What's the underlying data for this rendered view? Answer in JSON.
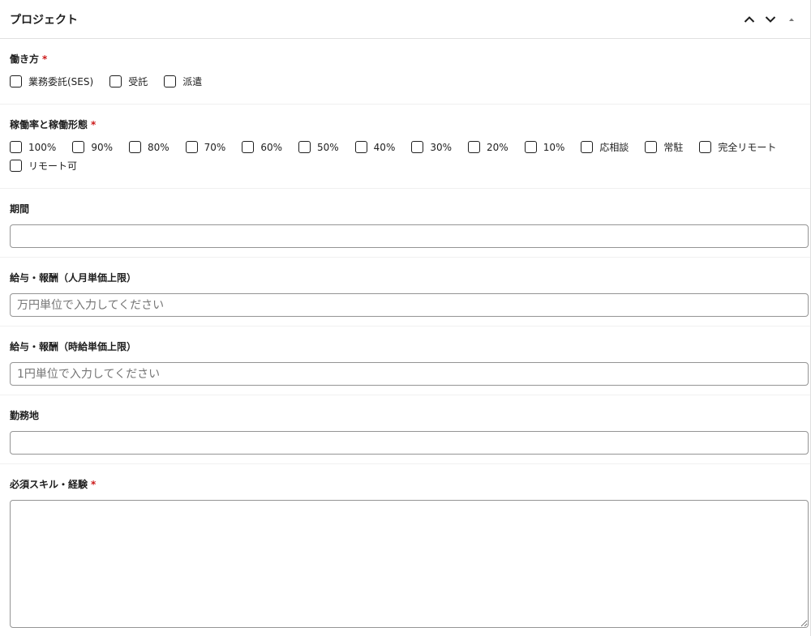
{
  "panel": {
    "title": "プロジェクト",
    "header_icons": [
      "chevron-up-icon",
      "chevron-down-icon",
      "triangle-up-icon"
    ]
  },
  "work_style": {
    "label": "働き方",
    "required_mark": "*",
    "options": [
      "業務委託(SES)",
      "受託",
      "派遣"
    ]
  },
  "utilization": {
    "label": "稼働率と稼働形態",
    "required_mark": "*",
    "options": [
      "100%",
      "90%",
      "80%",
      "70%",
      "60%",
      "50%",
      "40%",
      "30%",
      "20%",
      "10%",
      "応相談",
      "常駐",
      "完全リモート",
      "リモート可"
    ]
  },
  "period": {
    "label": "期間",
    "value": "",
    "placeholder": ""
  },
  "monthly_pay": {
    "label": "給与・報酬（人月単価上限）",
    "value": "",
    "placeholder": "万円単位で入力してください"
  },
  "hourly_pay": {
    "label": "給与・報酬（時給単価上限）",
    "value": "",
    "placeholder": "1円単位で入力してください"
  },
  "location": {
    "label": "勤務地",
    "value": "",
    "placeholder": ""
  },
  "skills": {
    "label": "必須スキル・経験",
    "required_mark": "*",
    "value": ""
  }
}
